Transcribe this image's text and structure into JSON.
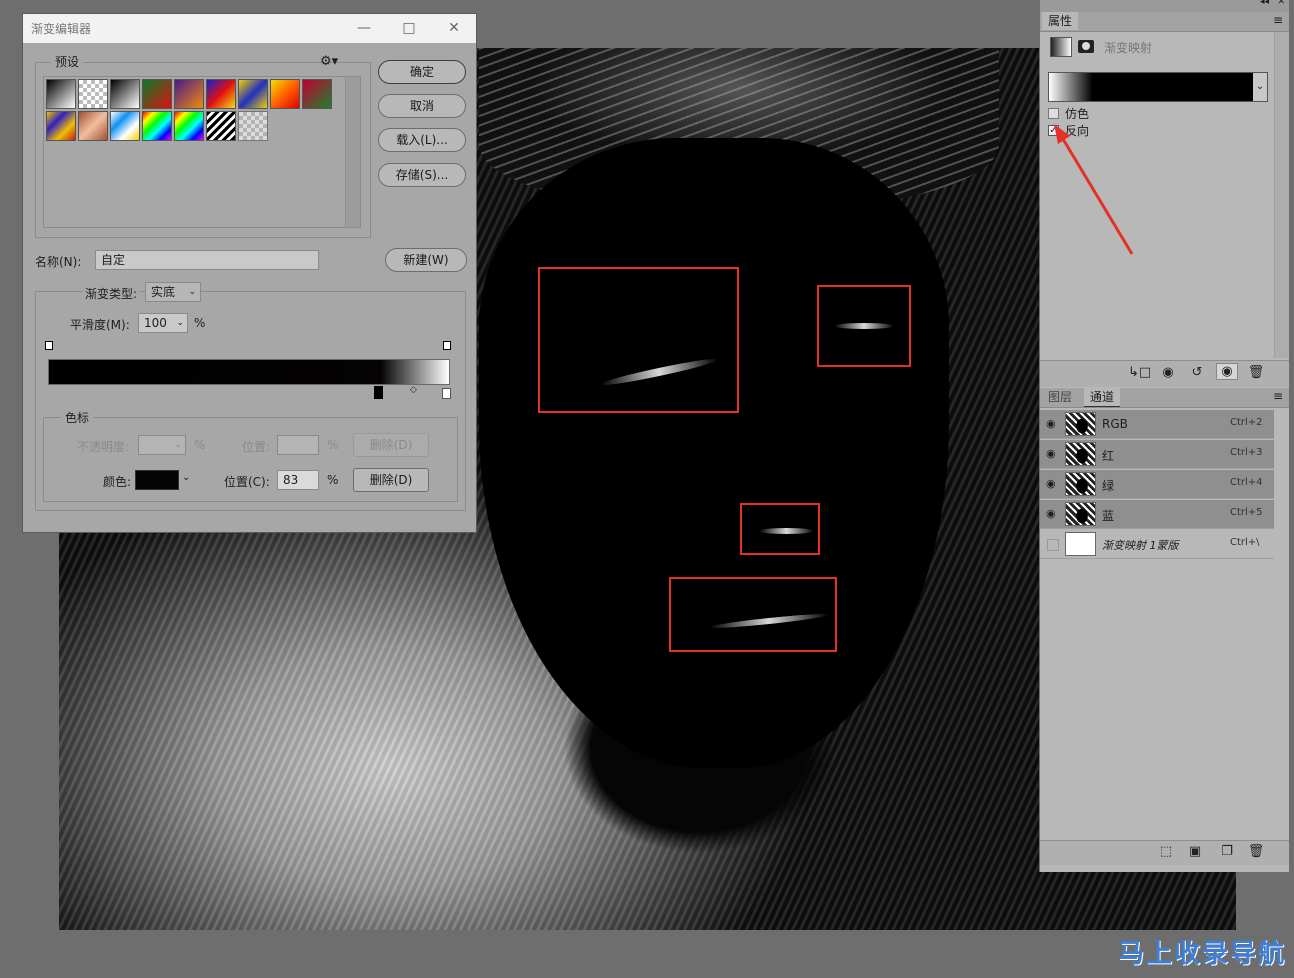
{
  "dialog": {
    "title": "渐变编辑器",
    "presets_label": "预设",
    "ok": "确定",
    "cancel": "取消",
    "load": "载入(L)...",
    "save": "存储(S)...",
    "name_label": "名称(N):",
    "name_value": "自定",
    "new": "新建(W)",
    "type_label": "渐变类型:",
    "type_value": "实底",
    "smooth_label": "平滑度(M):",
    "smooth_value": "100",
    "percent": "%",
    "stops_label": "色标",
    "opacity_label": "不透明度:",
    "position_label_disabled": "位置:",
    "delete_disabled": "删除(D)",
    "color_label": "颜色:",
    "position_label": "位置(C):",
    "position_value": "83",
    "delete": "删除(D)",
    "presets": [
      "linear-gradient(135deg,#000,#fff)",
      "checker",
      "linear-gradient(135deg,#000,#fff)",
      "linear-gradient(135deg,#0a7a2a,#e01010)",
      "linear-gradient(135deg,#4a1a8a,#f08a10)",
      "linear-gradient(135deg,#1020d0,#e01010,#f0e010)",
      "linear-gradient(135deg,#f0d000,#2030c0,#f0d000)",
      "linear-gradient(135deg,#f0e000,#ff6000,#e00000)",
      "linear-gradient(135deg,#c00030,#208030)",
      "linear-gradient(135deg,#f0c000,#3020c0,#f0c000,#c02020)",
      "linear-gradient(135deg,#a05030,#f0c0a0,#a05030)",
      "linear-gradient(135deg,#fff,#1090f0,#fff,#f0d000)",
      "linear-gradient(135deg,#f00,#ff0,#0f0,#0ff,#00f,#f0f)",
      "linear-gradient(135deg,#f00,#ff0,#0f0,#0ff,#00f,#f0f)",
      "repeating-linear-gradient(135deg,#000 0 3px,#fff 3px 6px)",
      "checker"
    ]
  },
  "props": {
    "tab": "属性",
    "title": "渐变映射",
    "dither": "仿色",
    "reverse": "反向"
  },
  "channels": {
    "tab_layers": "图层",
    "tab_channels": "通道",
    "rows": [
      {
        "name": "RGB",
        "shortcut": "Ctrl+2"
      },
      {
        "name": "红",
        "shortcut": "Ctrl+3"
      },
      {
        "name": "绿",
        "shortcut": "Ctrl+4"
      },
      {
        "name": "蓝",
        "shortcut": "Ctrl+5"
      },
      {
        "name": "渐变映射 1蒙版",
        "shortcut": "Ctrl+\\"
      }
    ]
  },
  "watermark": "马上收录导航"
}
